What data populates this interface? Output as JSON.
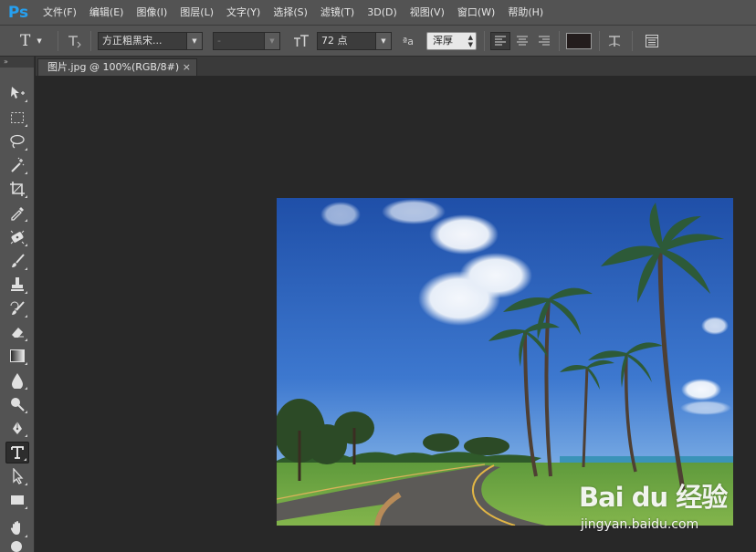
{
  "app": {
    "logo": "Ps"
  },
  "menu": [
    "文件(F)",
    "编辑(E)",
    "图像(I)",
    "图层(L)",
    "文字(Y)",
    "选择(S)",
    "滤镜(T)",
    "3D(D)",
    "视图(V)",
    "窗口(W)",
    "帮助(H)"
  ],
  "options_bar": {
    "tool_glyph": "T",
    "font_family": "方正粗黑宋...",
    "font_style": "-",
    "font_size": "72 点",
    "antialias_glyph": "ªa",
    "antialias": "浑厚"
  },
  "document": {
    "tab_title": "图片.jpg @ 100%(RGB/8#)",
    "tab_close": "×"
  },
  "colors": {
    "text_color_swatch": "#231c1c",
    "chrome": "#535353",
    "workspace": "#282828",
    "logo": "#26a0f0"
  },
  "tools": [
    "move-tool",
    "marquee-tool",
    "lasso-tool",
    "magic-wand-tool",
    "crop-tool",
    "eyedropper-tool",
    "spot-healing-tool",
    "brush-tool",
    "clone-stamp-tool",
    "history-brush-tool",
    "eraser-tool",
    "gradient-tool",
    "blur-tool",
    "dodge-tool",
    "pen-tool",
    "type-tool",
    "path-selection-tool",
    "rectangle-tool",
    "hand-tool",
    "zoom-tool"
  ],
  "watermark": {
    "logo": "Bai du 经验",
    "url": "jingyan.baidu.com"
  }
}
